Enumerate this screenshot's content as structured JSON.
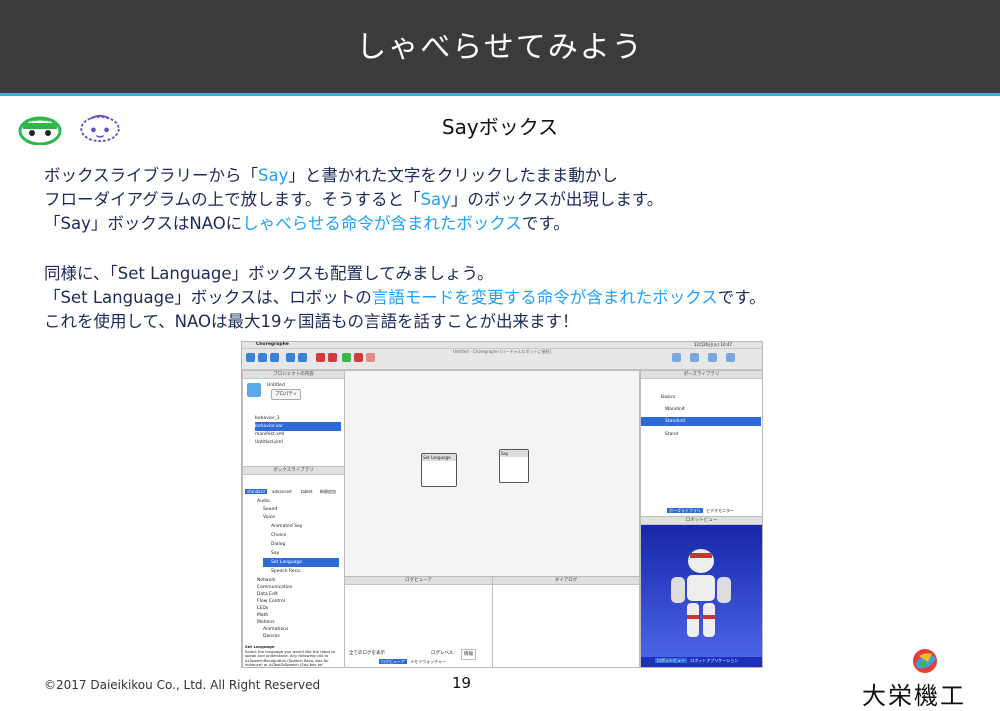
{
  "header": {
    "title": "しゃべらせてみよう"
  },
  "subtitle": "Sayボックス",
  "paragraph1": {
    "line1_a": "ボックスライブラリーから「",
    "line1_b": "Say",
    "line1_c": "」と書かれた文字をクリックしたまま動かし",
    "line2_a": "フローダイアグラムの上で放します。そうすると「",
    "line2_b": "Say",
    "line2_c": "」のボックスが出現します。",
    "line3_a": "「Say」ボックスはNAOに",
    "line3_b": "しゃべらせる命令が含まれたボックス",
    "line3_c": "です。"
  },
  "paragraph2": {
    "line1": "同様に、「Set Language」ボックスも配置してみましょう。",
    "line2_a": "「Set Language」ボックスは、ロボットの",
    "line2_b": "言語モードを変更する命令が含まれたボックス",
    "line2_c": "です。",
    "line3": "これを使用して、NAOは最大19ヶ国語もの言語を話すことが出来ます！"
  },
  "screenshot": {
    "app_name": "Choregraphe",
    "window_title": "Untitled - Choregraphe [バーチャルロボットに接続]",
    "project_panel": {
      "title": "プロジェクトの内容",
      "project_name": "Untitled",
      "property_button": "プロパティ",
      "files": [
        "behavior_1",
        "behavior.xar",
        "manifest.xml",
        "Untitled.pml"
      ]
    },
    "box_library": {
      "title": "ボックスライブラリ",
      "tabs": [
        "standard",
        "advanced",
        "tablet",
        "新規追加"
      ],
      "items": [
        "Audio",
        "Sound",
        "Voice",
        "Animated Say",
        "Choice",
        "Dialog",
        "Say",
        "Set Language",
        "Speech Reco.",
        "Network",
        "Communication",
        "Data Edit",
        "Flow Control",
        "LEDs",
        "Math",
        "Motions",
        "Animations",
        "Dances"
      ],
      "selected": "Set Language",
      "desc_title": "Set Language",
      "desc_text": "Select the language you would like the robot to speak and understand. Any following call to ALSpeechRecognition (Speech Reco. box for instance) or ALTextToSpeech (Say box for instance) will use this language."
    },
    "flow_boxes": [
      "Set Language",
      "Say"
    ],
    "log_panel": {
      "title": "ログビューア",
      "show_all": "全てのログを表示",
      "level_label": "ログレベル:",
      "level_value": "情報"
    },
    "dialog_panel": {
      "title": "ダイアログ"
    },
    "bottom_tabs": [
      "ログビューア",
      "メモリウォッチャー"
    ],
    "pose_library": {
      "title": "ポーズライブラリ",
      "folder": "Basics",
      "poses": [
        "Wandinit",
        "Standinit",
        "Stand"
      ],
      "selected": "Standinit"
    },
    "robot_view": {
      "title": "ロボットビュー"
    },
    "right_tabs": [
      "ポーズライブラリ",
      "ビデオモニター"
    ],
    "right_bottom_tabs": [
      "ロボットビュー",
      "ロボットアプリケーション"
    ],
    "clock": "12月26日(火) 10:47"
  },
  "footer": {
    "copyright": "©2017 Daieikikou Co., Ltd. All Right Reserved",
    "page": "19",
    "company": "大栄機工"
  },
  "colors": {
    "title_bg": "#3b3b3b",
    "accent_line": "#4aa8d8",
    "highlight": "#1fa0ff",
    "body_text": "#1b2a5a",
    "selection": "#2f6bd6"
  }
}
